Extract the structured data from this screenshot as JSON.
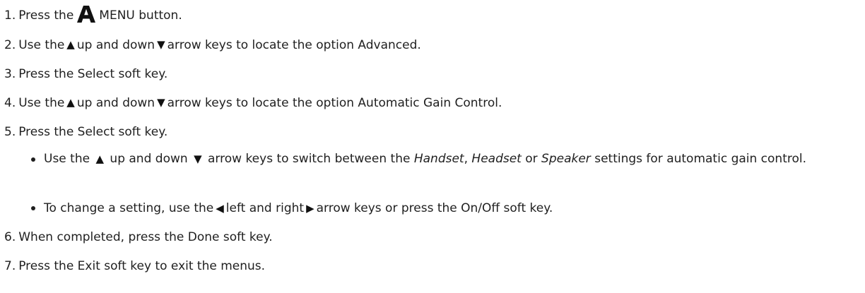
{
  "steps": [
    {
      "num": "1.",
      "before": "Press the",
      "after": "MENU button."
    },
    {
      "num": "2.",
      "before": "Use the",
      "mid": "up and down",
      "after": "arrow keys to locate the option Advanced."
    },
    {
      "num": "3.",
      "text": "Press the Select soft key."
    },
    {
      "num": "4.",
      "before": "Use the",
      "mid": "up and down",
      "after": "arrow keys to locate the option Automatic Gain Control."
    },
    {
      "num": "5.",
      "text": "Press the Select soft key."
    },
    {
      "num": "6.",
      "text": "When completed, press the Done soft key."
    },
    {
      "num": "7.",
      "text": "Press the Exit soft key to exit the menus."
    }
  ],
  "sub_items": [
    {
      "before": "Use the",
      "mid": "up and down",
      "after": "arrow keys to switch between the",
      "handset": "Handset",
      "comma": ",",
      "headset": "Headset",
      "or": "or",
      "speaker": "Speaker",
      "tail": "settings for automatic gain control."
    },
    {
      "before": "To change a setting, use the",
      "mid": "left and right",
      "after": "arrow keys or press the On/Off soft key."
    }
  ],
  "icons": {
    "up_arrow": "▲",
    "down_arrow": "▼",
    "left_arrow": "◀",
    "right_arrow": "▶",
    "menu": "menu-A-icon"
  }
}
